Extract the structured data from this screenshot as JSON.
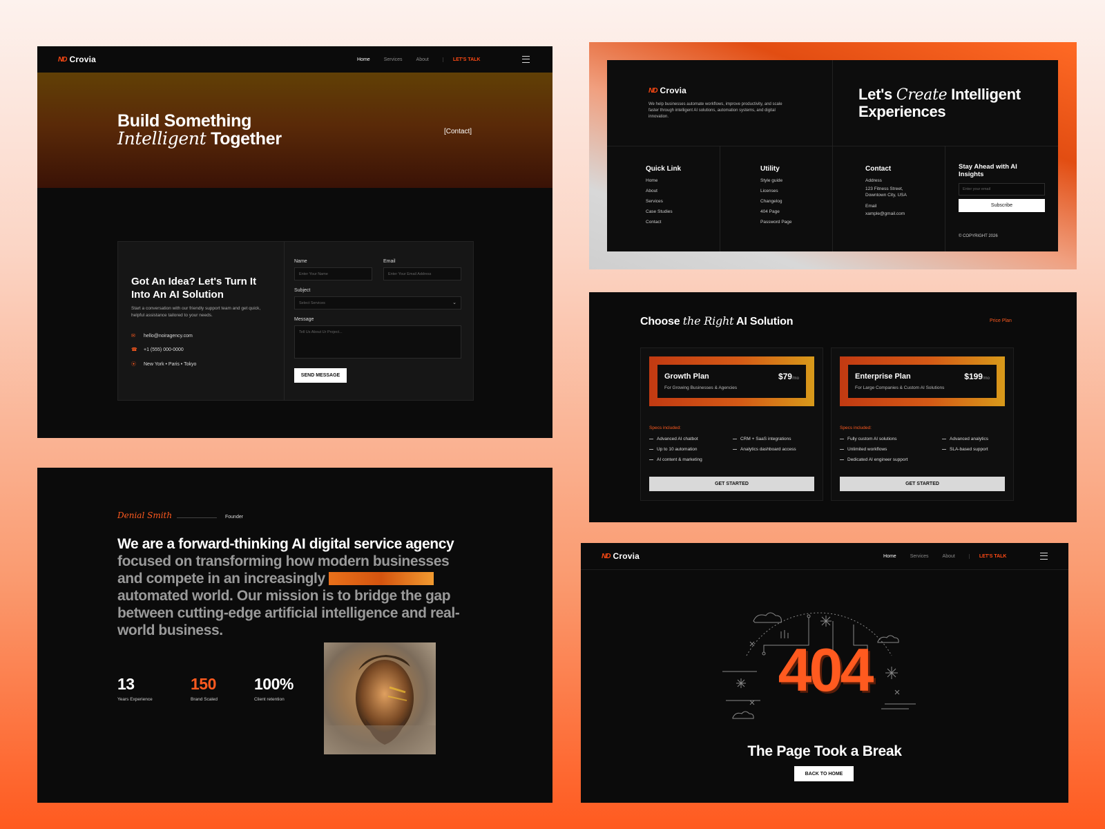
{
  "brand": {
    "name": "Crovia",
    "mark": "ND",
    "accent": "#ff5a1f"
  },
  "nav": {
    "home": "Home",
    "services": "Services",
    "about": "About",
    "cta": "LET'S TALK"
  },
  "contact_page": {
    "hero_line1": "Build Something",
    "hero_line2_italic": "Intelligent",
    "hero_line2_rest": "Together",
    "hero_tag": "[Contact]",
    "card_title": "Got An Idea? Let's Turn It Into An AI Solution",
    "card_desc": "Start a conversation with our friendly support team and get quick, helpful assistance tailored to your needs.",
    "email": "hello@noiragency.com",
    "phone": "+1 (555) 000-0000",
    "location": "New York • Paris • Tokyo",
    "labels": {
      "name": "Name",
      "email": "Email",
      "subject": "Subject",
      "message": "Message"
    },
    "placeholders": {
      "name": "Enter Your Name",
      "email": "Enter Your Email Address",
      "subject": "Select Services",
      "message": "Tell Us About Ur Project..."
    },
    "send": "SEND MESSAGE"
  },
  "footer": {
    "desc": "We help businesses automate workflows, improve productivity, and scale faster through intelligent AI solutions, automation systems, and digital innovation.",
    "headline_a": "Let's",
    "headline_italic": "Create",
    "headline_b": "Intelligent",
    "headline_c": "Experiences",
    "quick_title": "Quick Link",
    "quick_links": [
      "Home",
      "About",
      "Services",
      "Case Studies",
      "Contact"
    ],
    "utility_title": "Utility",
    "utility_links": [
      "Style guide",
      "Licenses",
      "Changelog",
      "404 Page",
      "Password Page"
    ],
    "contact_title": "Contact",
    "address_label": "Address",
    "address": "123 Fitness Street, Downtown City, USA",
    "email_label": "Email",
    "email": "xample@gmail.com",
    "newsletter_title": "Stay Ahead with AI Insights",
    "newsletter_placeholder": "Enter your email",
    "subscribe": "Subscribe",
    "copyright": "© COPYRIGHT 2026"
  },
  "pricing": {
    "title_a": "Choose",
    "title_italic": "the Right",
    "title_b": "AI Solution",
    "tag": "Price Plan",
    "specs_label": "Specs included:",
    "get_started": "GET STARTED",
    "plans": [
      {
        "name": "Growth Plan",
        "price": "$79",
        "period": "/mo",
        "desc": "For Growing Businesses & Agencies",
        "specs": [
          "Advanced AI chatbot",
          "CRM + SaaS integrations",
          "Up to 10 automation",
          "Analytics dashboard access",
          "AI content & marketing"
        ]
      },
      {
        "name": "Enterprise Plan",
        "price": "$199",
        "period": "/mo",
        "desc": "For Large Companies & Custom AI Solutions",
        "specs": [
          "Fully custom AI solutions",
          "Advanced analytics",
          "Unlimited workflows",
          "SLA-based support",
          "Dedicated AI engineer support"
        ]
      }
    ]
  },
  "about": {
    "signature": "Denial Smith",
    "role": "Founder",
    "statement_bright": "We are a forward-thinking AI digital service agency",
    "statement_l2_rest": "focused on transforming",
    "statement_l3": "how modern businesses and compete in",
    "statement_l4a": "an increasingly",
    "statement_l4b": "automated",
    "statement_l5": "world. Our mission is to bridge the gap",
    "statement_l6": "between cutting-edge artificial intelligence",
    "statement_l7": "and real-world business.",
    "stats": [
      {
        "value": "13",
        "label": "Years Experience"
      },
      {
        "value": "150",
        "label": "Brand Scaled"
      },
      {
        "value": "100%",
        "label": "Client retention"
      }
    ]
  },
  "error_page": {
    "code": "404",
    "title": "The Page Took a Break",
    "button": "BACK TO HOME"
  }
}
